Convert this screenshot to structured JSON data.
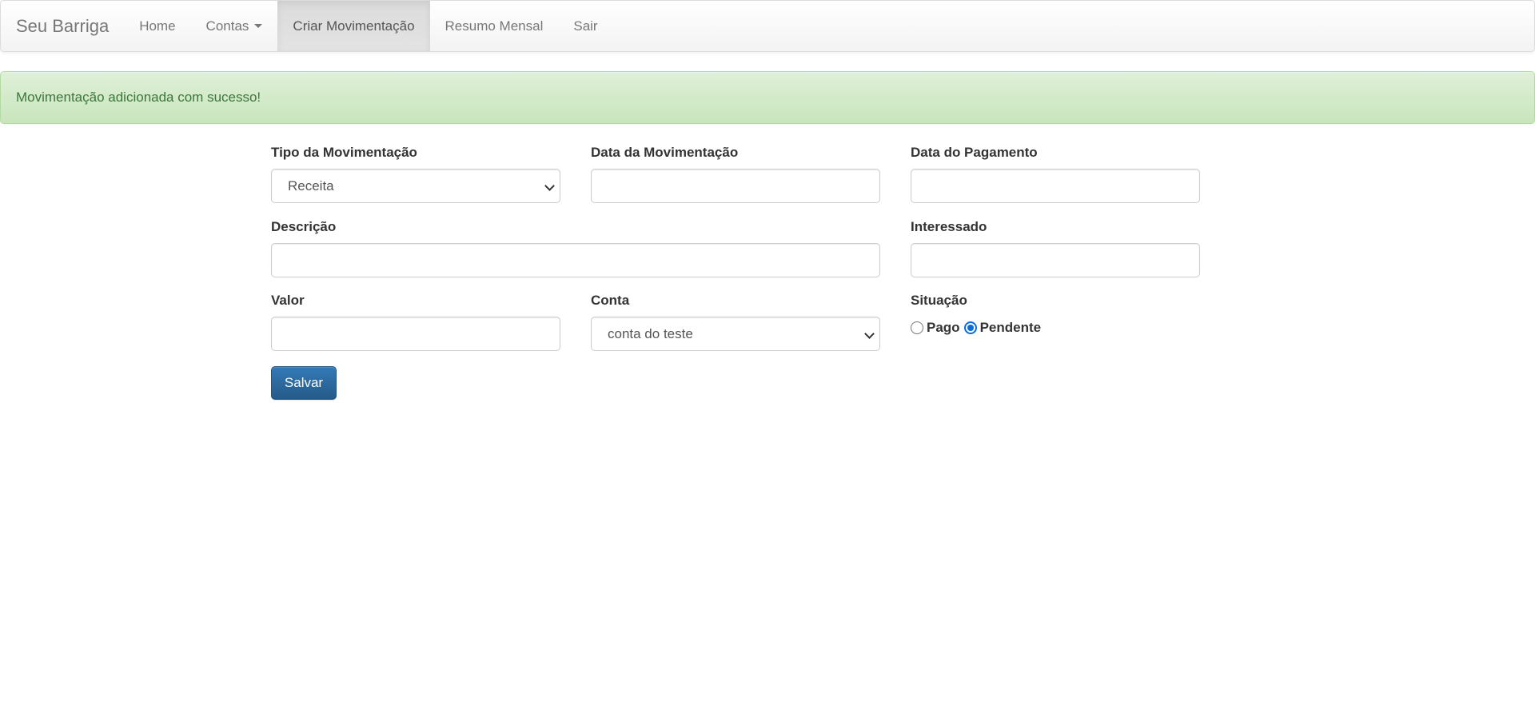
{
  "navbar": {
    "brand": "Seu Barriga",
    "items": [
      {
        "label": "Home"
      },
      {
        "label": "Contas"
      },
      {
        "label": "Criar Movimentação"
      },
      {
        "label": "Resumo Mensal"
      },
      {
        "label": "Sair"
      }
    ],
    "active_item": "Criar Movimentação"
  },
  "alert": {
    "message": "Movimentação adicionada com sucesso!",
    "color": "#3c763d"
  },
  "form": {
    "tipo": {
      "label": "Tipo da Movimentação",
      "value": "Receita"
    },
    "data_movimentacao": {
      "label": "Data da Movimentação",
      "value": ""
    },
    "data_pagamento": {
      "label": "Data do Pagamento",
      "value": ""
    },
    "descricao": {
      "label": "Descrição",
      "value": ""
    },
    "interessado": {
      "label": "Interessado",
      "value": ""
    },
    "valor": {
      "label": "Valor",
      "value": ""
    },
    "conta": {
      "label": "Conta",
      "value": "conta do teste"
    },
    "situacao": {
      "label": "Situação",
      "options": [
        {
          "label": "Pago",
          "checked": false
        },
        {
          "label": "Pendente",
          "checked": true
        }
      ]
    },
    "submit_label": "Salvar"
  },
  "colors": {
    "primary_button": "#337ab7",
    "radio_checked": "#0b6cd8",
    "alert_bg": "#dff0d8"
  }
}
